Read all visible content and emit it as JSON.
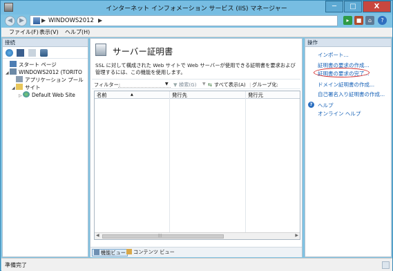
{
  "window": {
    "title": "インターネット インフォメーション サービス (IIS) マネージャー",
    "min_label": "─",
    "max_label": "□",
    "close_label": "X"
  },
  "address": {
    "back_label": "◀",
    "forward_label": "▶",
    "sep1": "▶",
    "crumb": "WINDOWS2012",
    "sep2": "▶"
  },
  "menu": {
    "file": "ファイル(F)",
    "view": "表示(V)",
    "help": "ヘルプ(H)"
  },
  "connections": {
    "header": "接続",
    "tree": [
      {
        "label": "スタート ページ",
        "icon": "start-page-icon"
      },
      {
        "label": "WINDOWS2012 (TORITO",
        "icon": "server-icon"
      },
      {
        "label": "アプリケーション プール",
        "icon": "app-pool-icon"
      },
      {
        "label": "サイト",
        "icon": "sites-folder-icon"
      },
      {
        "label": "Default Web Site",
        "icon": "globe-icon"
      }
    ]
  },
  "main": {
    "title": "サーバー証明書",
    "description": "SSL に対して構成された Web サイトで Web サーバーが使用できる証明書を要求および管理するには、この機能を使用します。",
    "filter_label": "フィルター:",
    "search_label": "検索(G)",
    "show_all_label": "すべて表示(A)",
    "group_label": "グループ化:",
    "columns": [
      "名前",
      "発行先",
      "発行元"
    ],
    "scroll_left": "◀",
    "scroll_right": "▶",
    "scroll_grip": "|||",
    "tabs": [
      "機能ビュー",
      "コンテンツ ビュー"
    ]
  },
  "actions": {
    "header": "操作",
    "items": [
      "インポート...",
      "証明書の要求の作成...",
      "証明書の要求の完了...",
      "ドメイン証明書の作成...",
      "自己署名入り証明書の作成..."
    ],
    "help_label": "ヘルプ",
    "online_help_label": "オンライン ヘルプ",
    "highlight_color": "#d42a2a"
  },
  "status": {
    "text": "準備完了"
  }
}
